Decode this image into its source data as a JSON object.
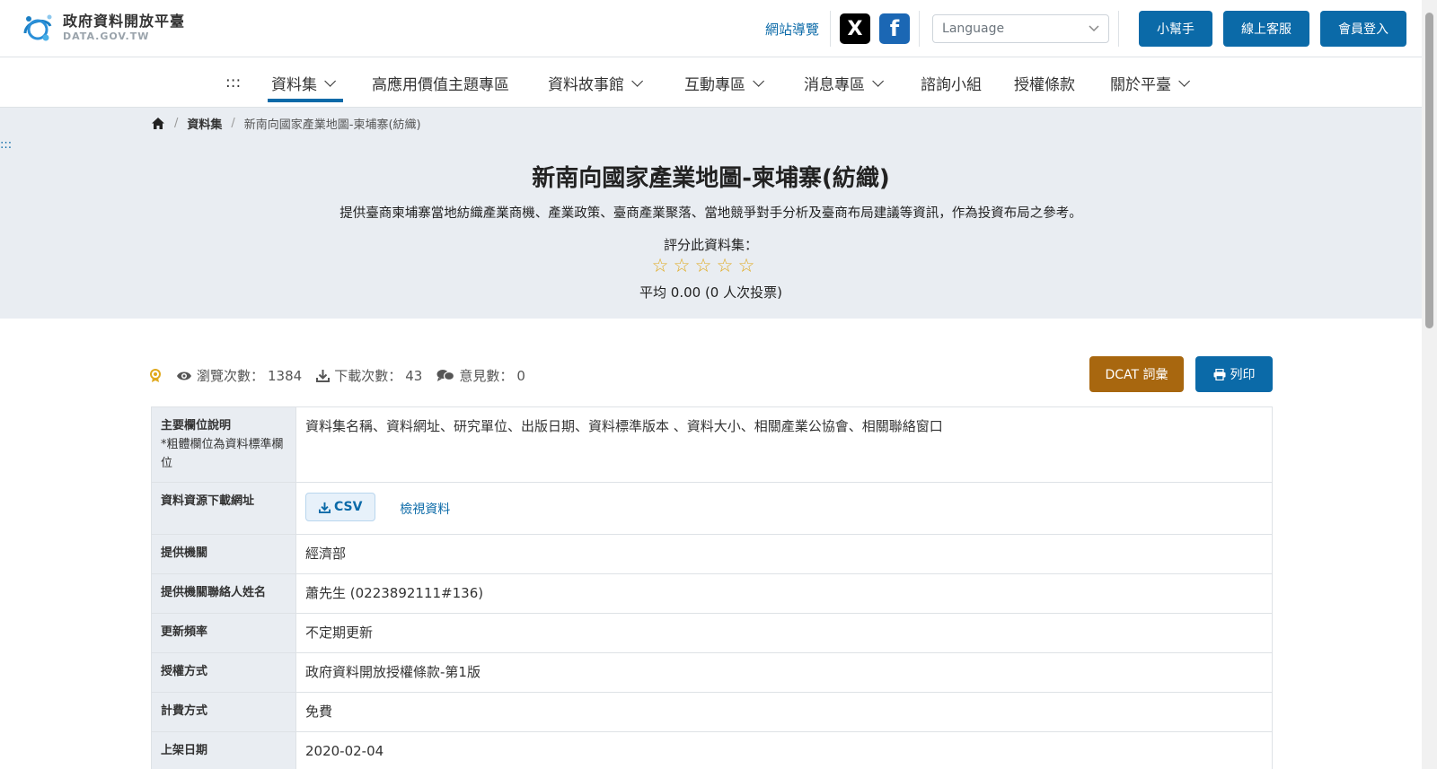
{
  "header": {
    "logo_title": "政府資料開放平臺",
    "logo_sub": "DATA.GOV.TW",
    "sitemap_label": "網站導覽",
    "language_placeholder": "Language",
    "buttons": [
      "小幫手",
      "線上客服",
      "會員登入"
    ]
  },
  "nav": {
    "accessibility_mark": ":::",
    "items": [
      {
        "label": "資料集",
        "dropdown": true
      },
      {
        "label": "高應用價值主題專區",
        "dropdown": false
      },
      {
        "label": "資料故事館",
        "dropdown": true
      },
      {
        "label": "互動專區",
        "dropdown": true
      },
      {
        "label": "消息專區",
        "dropdown": true
      },
      {
        "label": "諮詢小組",
        "dropdown": false
      },
      {
        "label": "授權條款",
        "dropdown": false
      },
      {
        "label": "關於平臺",
        "dropdown": true
      }
    ]
  },
  "breadcrumb": {
    "section": "資料集",
    "current": "新南向國家產業地圖-柬埔寨(紡織)"
  },
  "side_mark": ":::",
  "dataset": {
    "title": "新南向國家產業地圖-柬埔寨(紡織)",
    "description": "提供臺商柬埔寨當地紡織產業商機、產業政策、臺商產業聚落、當地競爭對手分析及臺商布局建議等資訊，作為投資布局之參考。",
    "rate_label": "評分此資料集：",
    "stars": [
      "☆",
      "☆",
      "☆",
      "☆",
      "☆"
    ],
    "average_text": "平均 0.00 (0 人次投票)"
  },
  "stats": {
    "views_label": "瀏覽次數：",
    "views": "1384",
    "downloads_label": "下載次數：",
    "downloads": "43",
    "comments_label": "意見數：",
    "comments": "0"
  },
  "actions": {
    "dcat_label": "DCAT 詞彙",
    "print_label": "列印"
  },
  "details": {
    "fields_key": "主要欄位說明",
    "fields_note": "*粗體欄位為資料標準欄位",
    "fields_value": "資料集名稱、資料網址、研究單位、出版日期、資料標準版本 、資料大小、相關產業公協會、相關聯絡窗口",
    "download_key": "資料資源下載網址",
    "csv_label": "CSV",
    "view_label": "檢視資料",
    "provider_key": "提供機關",
    "provider_value": "經濟部",
    "contact_key": "提供機關聯絡人姓名",
    "contact_value": "蕭先生 (0223892111#136)",
    "freq_key": "更新頻率",
    "freq_value": "不定期更新",
    "license_key": "授權方式",
    "license_value": "政府資料開放授權條款-第1版",
    "fee_key": "計費方式",
    "fee_value": "免費",
    "date_key": "上架日期",
    "date_value": "2020-02-04"
  },
  "colors": {
    "primary": "#0b6aa8",
    "dcat": "#a8670f",
    "hero_bg": "#e9edf2",
    "star": "#e0a91d"
  }
}
